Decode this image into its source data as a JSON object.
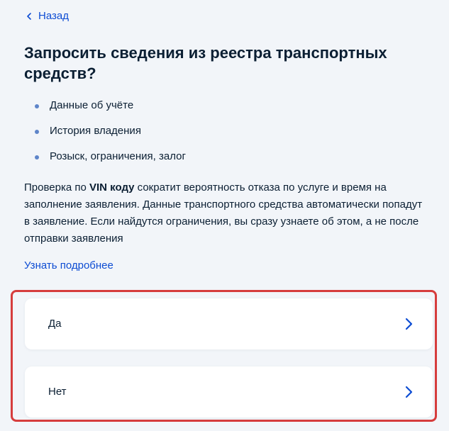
{
  "nav": {
    "back_label": "Назад"
  },
  "page": {
    "title": "Запросить сведения из реестра транспортных средств?",
    "bullets": [
      "Данные об учёте",
      "История владения",
      "Розыск, ограничения, залог"
    ],
    "description": {
      "prefix": "Проверка по ",
      "bold": "VIN коду",
      "suffix": " сократит вероятность отказа по услуге и время на заполнение заявления. Данные транспортного средства автоматически попадут в заявление. Если найдутся ограничения, вы сразу узнаете об этом, а не после отправки заявления"
    },
    "more_link": "Узнать подробнее"
  },
  "options": [
    {
      "label": "Да",
      "icon": "chevron-right-icon"
    },
    {
      "label": "Нет",
      "icon": "chevron-right-icon"
    }
  ],
  "colors": {
    "background": "#f2f5f9",
    "text": "#0b1f33",
    "link": "#0d4cd3",
    "bullet": "#5e85c9",
    "highlight_border": "#d63d3d",
    "card": "#ffffff"
  }
}
